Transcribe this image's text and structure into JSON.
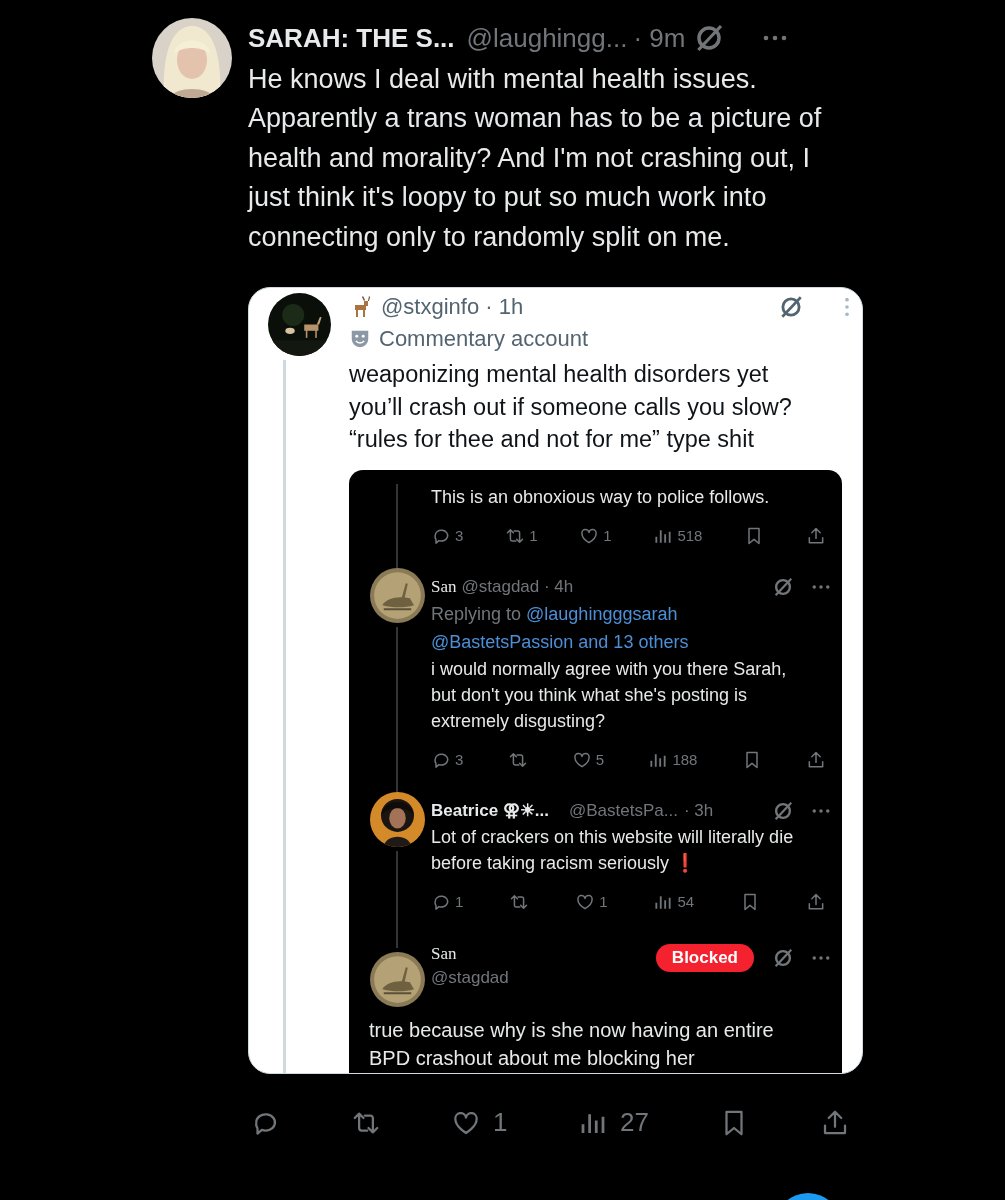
{
  "post": {
    "author": "SARAH: THE S...",
    "handle": "@laughingg...",
    "time": "· 9m",
    "text": "He knows I deal with mental health issues. Apparently a trans woman has to be a picture of health and morality? And I'm not crashing out, I just think it's loopy to put so much work into connecting only to randomly split on me.",
    "quote": {
      "handle": "@stxginfo · 1h",
      "label": "Commentary account",
      "text": "weaponizing mental health disorders yet you’ll crash out if someone calls you slow? “rules for thee and not for me” type shit",
      "screenshot": {
        "items": [
          {
            "kind": "tail",
            "text": "This is an obnoxious way to police follows.",
            "actions": [
              {
                "kind": "reply",
                "count": "3"
              },
              {
                "kind": "repost",
                "count": "1"
              },
              {
                "kind": "like",
                "count": "1"
              },
              {
                "kind": "views",
                "count": "518"
              },
              {
                "kind": "bookmark"
              },
              {
                "kind": "share"
              }
            ]
          },
          {
            "kind": "reply",
            "name": "San",
            "handle": "@stagdad · 4h",
            "replying": {
              "label": "Replying to",
              "links": [
                "@laughingggsarah",
                "@BastetsPassion and 13 others"
              ]
            },
            "text": "i would normally agree with you there Sarah, but don't you think what she's posting is extremely disgusting?",
            "actions": [
              {
                "kind": "reply",
                "count": "3"
              },
              {
                "kind": "repost"
              },
              {
                "kind": "like",
                "count": "5"
              },
              {
                "kind": "views",
                "count": "188"
              },
              {
                "kind": "bookmark"
              },
              {
                "kind": "share"
              }
            ]
          },
          {
            "kind": "reply",
            "name": "Beatrice ⚢☀...",
            "handle": "@BastetsPa...",
            "time": "· 3h",
            "text": "Lot of crackers on this website will literally die before taking racism seriously",
            "mark": "❗",
            "actions": [
              {
                "kind": "reply",
                "count": "1"
              },
              {
                "kind": "repost"
              },
              {
                "kind": "like",
                "count": "1"
              },
              {
                "kind": "views",
                "count": "54"
              },
              {
                "kind": "bookmark"
              },
              {
                "kind": "share"
              }
            ]
          },
          {
            "kind": "profile",
            "name": "San",
            "handle": "@stagdad",
            "badge": "Blocked",
            "text": "true because why is she now having an entire BPD crashout about me blocking her"
          }
        ]
      }
    },
    "actions": [
      {
        "kind": "reply"
      },
      {
        "kind": "repost"
      },
      {
        "kind": "like",
        "count": "1"
      },
      {
        "kind": "views",
        "count": "27"
      },
      {
        "kind": "bookmark"
      },
      {
        "kind": "share"
      }
    ]
  }
}
